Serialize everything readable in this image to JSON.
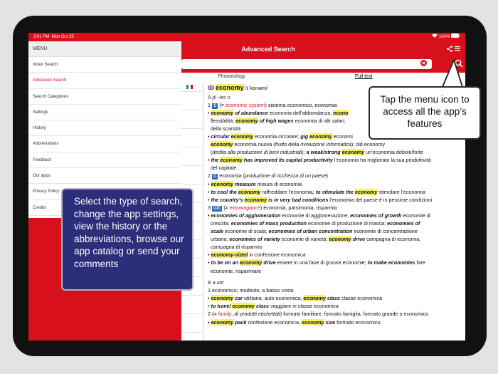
{
  "status": {
    "time": "3:01 PM",
    "date": "Mon Oct 25",
    "battery": "100%"
  },
  "header": {
    "title": "Advanced Search"
  },
  "search": {
    "value": "",
    "placeholder": ""
  },
  "tabs": [
    {
      "label": "Phraseology"
    },
    {
      "label": "Full text"
    }
  ],
  "menu": {
    "header": "MENU",
    "items": [
      {
        "label": "Index Search"
      },
      {
        "label": "Advanced Search"
      },
      {
        "label": "Search Categories"
      },
      {
        "label": "Settings"
      },
      {
        "label": "History"
      },
      {
        "label": "Abbreviations"
      },
      {
        "label": "Feedback"
      },
      {
        "label": "Our apps"
      },
      {
        "label": "Privacy Policy"
      },
      {
        "label": "Credits"
      }
    ]
  },
  "entry": {
    "headword": "economy",
    "pron": "/ɪˈkɒnəmi/",
    "secA": "A",
    "posA": "pl",
    "plural": "-ies",
    "posA2": "n",
    "secB": "B",
    "posB": "a attr"
  },
  "callouts": {
    "right": "Tap the menu icon to access all the app’s features",
    "left": "Select the type of search, change the app settings, view the history or the abbreviations, browse our app catalog or send your comments"
  },
  "colors": {
    "brand": "#d8101c",
    "highlight": "#f5ef6a",
    "callout_dark": "#2c2e7a",
    "badge": "#2a6bbf"
  }
}
